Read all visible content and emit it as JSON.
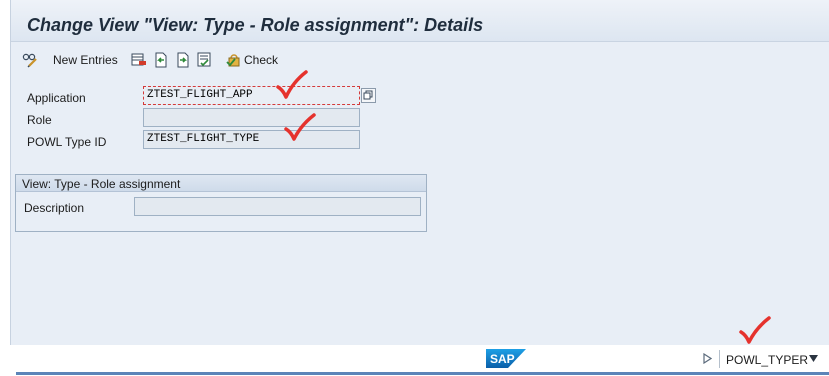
{
  "window": {
    "title": "Change View \"View: Type - Role assignment\": Details"
  },
  "toolbar": {
    "new_entries_label": "New Entries",
    "check_label": "Check",
    "icons": [
      "glasses-change-icon",
      "delete-icon",
      "undo-icon",
      "next-icon",
      "select-icon",
      "check-icon"
    ]
  },
  "form": {
    "application": {
      "label": "Application",
      "value": "ZTEST_FLIGHT_APP"
    },
    "role": {
      "label": "Role",
      "value": ""
    },
    "powl_type_id": {
      "label": "POWL Type ID",
      "value": "ZTEST_FLIGHT_TYPE"
    }
  },
  "group": {
    "title": "View: Type - Role assignment",
    "description": {
      "label": "Description",
      "value": ""
    }
  },
  "status": {
    "logo_text": "SAP",
    "system": "POWL_TYPER"
  },
  "colors": {
    "annotation": "#e5322d",
    "accent": "#5c84b8"
  }
}
